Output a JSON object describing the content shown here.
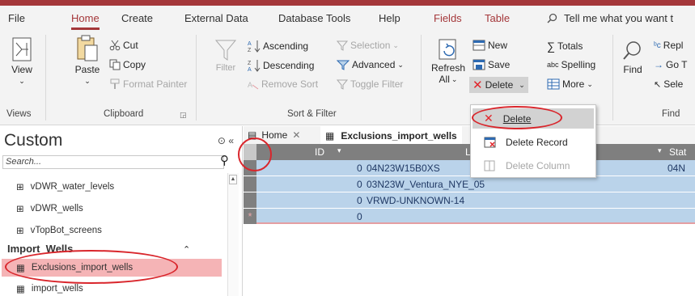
{
  "ribbon_tabs": [
    "File",
    "Home",
    "Create",
    "External Data",
    "Database Tools",
    "Help",
    "Fields",
    "Table"
  ],
  "tell_me": "Tell me what you want t",
  "groups": {
    "views": "Views",
    "clipboard": "Clipboard",
    "sort_filter": "Sort & Filter",
    "find": "Find"
  },
  "views": {
    "view": "View"
  },
  "clipboard": {
    "paste": "Paste",
    "cut": "Cut",
    "copy": "Copy",
    "format_painter": "Format Painter"
  },
  "sort": {
    "filter": "Filter",
    "ascending": "Ascending",
    "descending": "Descending",
    "remove_sort": "Remove Sort",
    "selection": "Selection",
    "advanced": "Advanced",
    "toggle_filter": "Toggle Filter"
  },
  "records": {
    "refresh": "Refresh",
    "all": "All",
    "new": "New",
    "save": "Save",
    "delete": "Delete",
    "totals": "Totals",
    "spelling": "Spelling",
    "more": "More"
  },
  "find": {
    "find": "Find",
    "replace": "Repl",
    "goto": "Go T",
    "select": "Sele"
  },
  "nav": {
    "title": "Custom",
    "search_placeholder": "Search...",
    "items": [
      "vDWR_water_levels",
      "vDWR_wells",
      "vTopBot_screens"
    ],
    "section": "Import_Wells",
    "group_items": [
      "Exclusions_import_wells",
      "import_wells"
    ]
  },
  "doc_tabs": [
    "Home",
    "Exclusions_import_wells"
  ],
  "grid": {
    "headers": [
      "ID",
      "Loc",
      "Stat"
    ],
    "rows": [
      {
        "id": "0",
        "loc": "04N23W15B0XS",
        "stat": "04N"
      },
      {
        "id": "0",
        "loc": "03N23W_Ventura_NYE_05",
        "stat": ""
      },
      {
        "id": "0",
        "loc": "VRWD-UNKNOWN-14",
        "stat": ""
      }
    ],
    "new_row": {
      "marker": "*",
      "id": "0"
    }
  },
  "dropdown": {
    "delete": "Delete",
    "delete_record": "Delete Record",
    "delete_column": "Delete Column"
  },
  "colors": {
    "access_red": "#a4373a",
    "highlight": "#f5b4b6",
    "selection": "#bad3ea",
    "annotation": "#d9262c"
  }
}
